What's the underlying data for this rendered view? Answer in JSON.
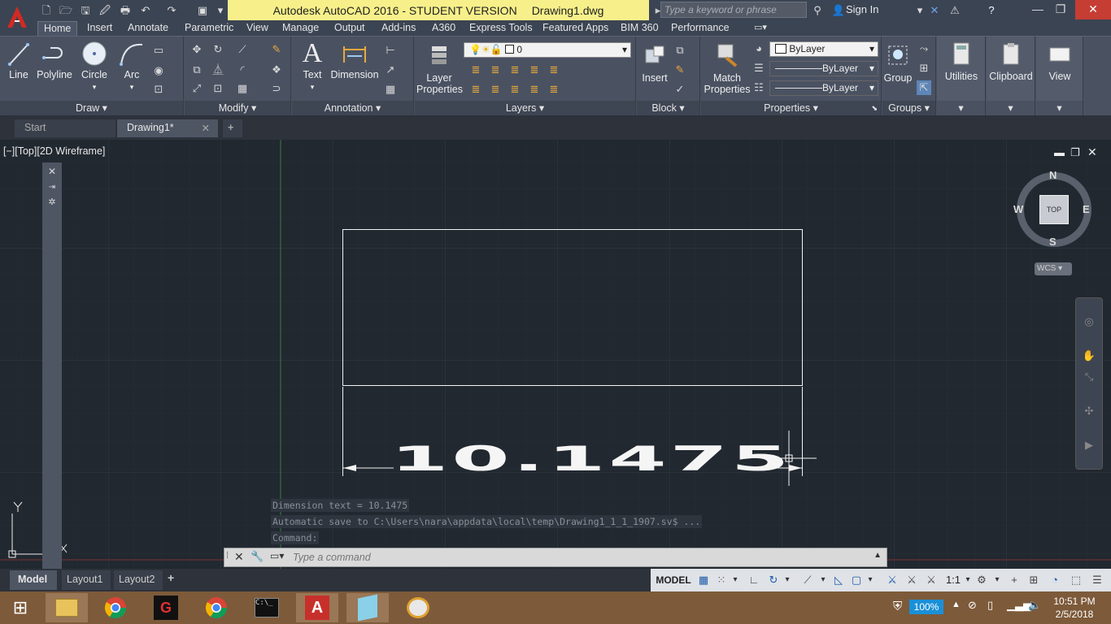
{
  "titlebar": {
    "title": "Autodesk AutoCAD 2016 - STUDENT VERSION",
    "document": "Drawing1.dwg",
    "search_placeholder": "Type a keyword or phrase",
    "sign_in": "Sign In"
  },
  "ribbon_tabs": [
    "Home",
    "Insert",
    "Annotate",
    "Parametric",
    "View",
    "Manage",
    "Output",
    "Add-ins",
    "A360",
    "Express Tools",
    "Featured Apps",
    "BIM 360",
    "Performance"
  ],
  "panels": {
    "draw": {
      "label": "Draw",
      "tools": [
        "Line",
        "Polyline",
        "Circle",
        "Arc"
      ]
    },
    "modify": {
      "label": "Modify"
    },
    "annotation": {
      "label": "Annotation",
      "tools": [
        "Text",
        "Dimension"
      ]
    },
    "layers": {
      "label": "Layers",
      "tool": "Layer Properties",
      "current_layer": "0"
    },
    "block": {
      "label": "Block",
      "tool": "Insert"
    },
    "properties": {
      "label": "Properties",
      "tool": "Match Properties",
      "color": "ByLayer",
      "linetype": "ByLayer",
      "lineweight": "ByLayer"
    },
    "groups": {
      "label": "Groups",
      "tool": "Group"
    },
    "utilities": {
      "label": "Utilities"
    },
    "clipboard": {
      "label": "Clipboard"
    },
    "view": {
      "label": "View"
    }
  },
  "doc_tabs": {
    "start": "Start",
    "active": "Drawing1*"
  },
  "viewport": {
    "label": "[−][Top][2D Wireframe]",
    "dimension_text": "10.1475",
    "viewcube": {
      "n": "N",
      "s": "S",
      "e": "E",
      "w": "W",
      "face": "TOP",
      "ucs": "WCS"
    }
  },
  "command": {
    "history": [
      "Dimension text = 10.1475",
      "Automatic save to C:\\Users\\nara\\appdata\\local\\temp\\Drawing1_1_1_1907.sv$ ...",
      "Command:"
    ],
    "placeholder": "Type a command"
  },
  "layout_tabs": [
    "Model",
    "Layout1",
    "Layout2"
  ],
  "status": {
    "model": "MODEL",
    "scale": "1:1"
  },
  "taskbar": {
    "battery": "100%",
    "time": "10:51 PM",
    "date": "2/5/2018"
  },
  "colors": {
    "accent": "#1c5aa8",
    "title_bg": "#f7f08a",
    "canvas": "#212830"
  }
}
